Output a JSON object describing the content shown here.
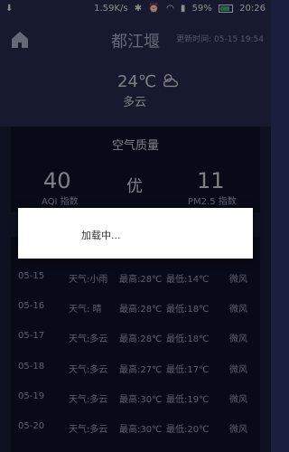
{
  "status": {
    "netspeed": "1.59K/s",
    "battery_pct": "59%",
    "time": "20:26"
  },
  "header": {
    "city": "都江堰",
    "update_label": "更新时间: 05-15 19:54"
  },
  "current": {
    "temp": "24℃",
    "condition": "多云"
  },
  "air_quality": {
    "title": "空气质量",
    "aqi_value": "40",
    "aqi_label": "AQI 指数",
    "quality": "优",
    "pm25_value": "11",
    "pm25_label": "PM2.5 指数"
  },
  "forecast": [
    {
      "date": "05-15",
      "weather": "天气:小雨",
      "high": "最高:28℃",
      "low": "最低:14℃",
      "wind": "微风"
    },
    {
      "date": "05-16",
      "weather": "天气:  晴",
      "high": "最高:28℃",
      "low": "最低:18℃",
      "wind": "微风"
    },
    {
      "date": "05-17",
      "weather": "天气:多云",
      "high": "最高:28℃",
      "low": "最低:18℃",
      "wind": "微风"
    },
    {
      "date": "05-18",
      "weather": "天气:多云",
      "high": "最高:27℃",
      "low": "最低:17℃",
      "wind": "微风"
    },
    {
      "date": "05-19",
      "weather": "天气:多云",
      "high": "最高:30℃",
      "low": "最低:19℃",
      "wind": "微风"
    },
    {
      "date": "05-20",
      "weather": "天气:多云",
      "high": "最高:30℃",
      "low": "最低:20℃",
      "wind": "微风"
    }
  ],
  "dialog": {
    "text": "加载中..."
  },
  "colors": {
    "background": "#1a1f3d",
    "header": "#2a2f57",
    "panel": "#11132b",
    "battery": "#2ecc71"
  }
}
